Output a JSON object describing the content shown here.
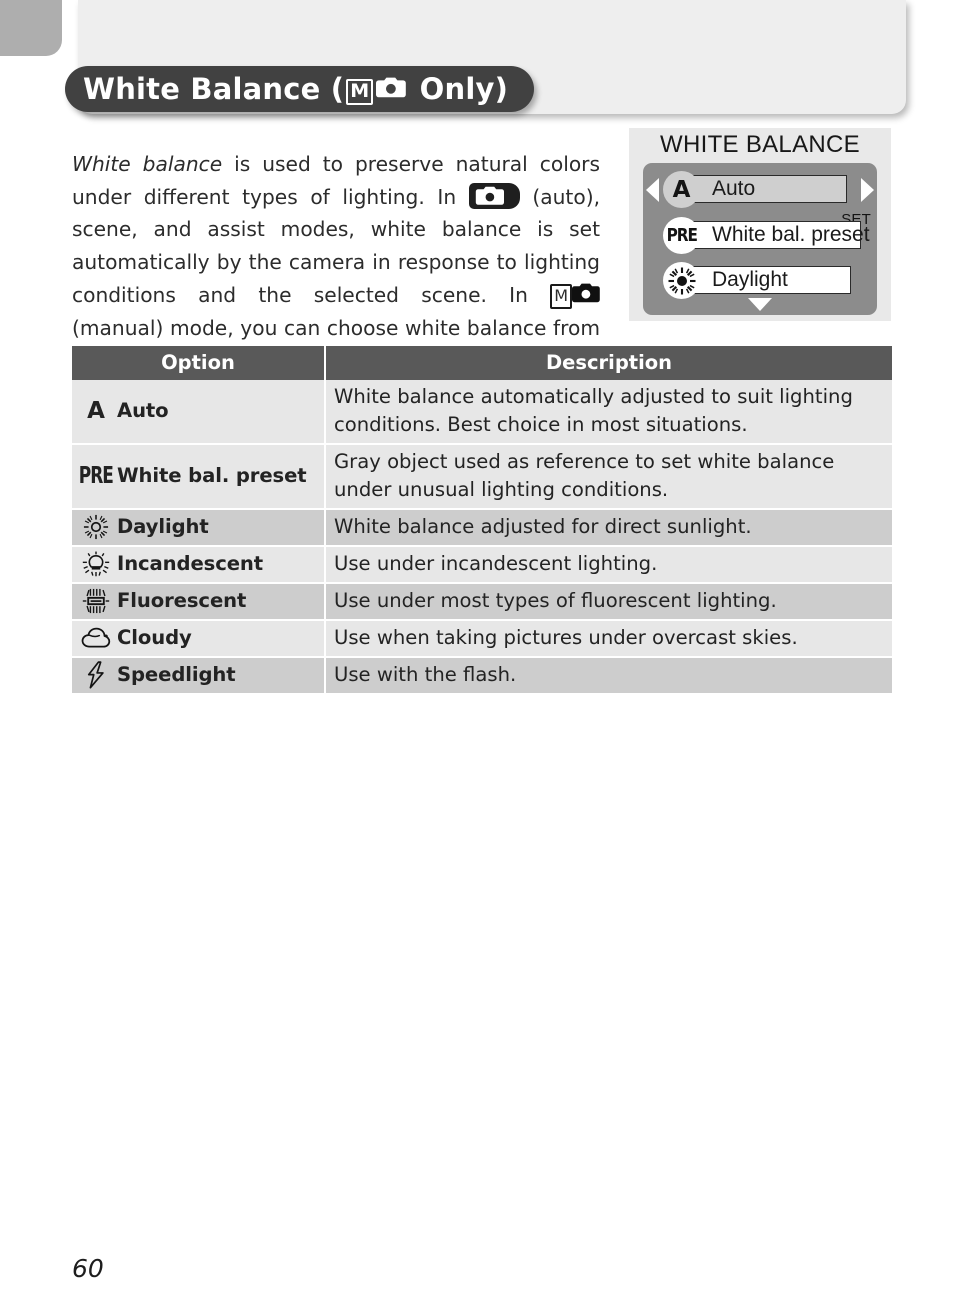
{
  "page": {
    "number": "60"
  },
  "header": {
    "title_before": "White Balance (",
    "mode_m_letter": "M",
    "mode_camera_icon": "camera-icon",
    "title_after": " Only)"
  },
  "body": {
    "lead_italic": "White balance",
    "text_1": " is used to preserve natural colors under different types of lighting.  In ",
    "auto_badge_icon": "auto-camera-badge-icon",
    "text_2": " (auto), scene, and assist modes, white balance is set automatically by the camera in response to lighting conditions and the selected scene.  In ",
    "manual_m_letter": "M",
    "manual_camera_icon": "camera-icon",
    "text_3": " (manual) mode, you can choose white balance from the following options:"
  },
  "lcd": {
    "title": "WHITE BALANCE",
    "set_label": "SET",
    "left_arrow": "left-arrow-icon",
    "right_arrow": "right-arrow-icon",
    "down_arrow": "down-arrow-icon",
    "items": [
      {
        "icon": "letter-a-icon",
        "icon_text": "A",
        "label": "Auto",
        "selected": true
      },
      {
        "icon": "pre-icon",
        "icon_text": "PRE",
        "label": "White bal. preset",
        "selected": false
      },
      {
        "icon": "sun-icon",
        "icon_text": "",
        "label": "Daylight",
        "selected": false
      }
    ]
  },
  "table": {
    "headers": {
      "option": "Option",
      "description": "Description"
    },
    "rows": [
      {
        "icon": "letter-a-icon",
        "icon_text": "A",
        "label": "Auto",
        "description": "White balance automatically adjusted to suit lighting conditions.  Best choice in most situations."
      },
      {
        "icon": "pre-icon",
        "icon_text": "PRE",
        "label": "White bal. preset",
        "description": "Gray object used as reference to set white balance under unusual lighting conditions."
      },
      {
        "icon": "sun-icon",
        "icon_text": "",
        "label": "Daylight",
        "description": "White balance adjusted for direct sunlight."
      },
      {
        "icon": "lightbulb-icon",
        "icon_text": "",
        "label": "Incandescent",
        "description": "Use under incandescent lighting."
      },
      {
        "icon": "fluorescent-tube-icon",
        "icon_text": "",
        "label": "Fluorescent",
        "description": "Use under most types of fluorescent lighting."
      },
      {
        "icon": "cloud-icon",
        "icon_text": "",
        "label": "Cloudy",
        "description": "Use when taking pictures under overcast skies."
      },
      {
        "icon": "flash-bolt-icon",
        "icon_text": "",
        "label": "Speedlight",
        "description": "Use with the flash."
      }
    ]
  },
  "colors": {
    "banner": "#414141",
    "table_header": "#595959",
    "row_dark": "#cdcdcd",
    "row_light": "#e7e7e7",
    "lcd_screen": "#8c8c8c",
    "corner_tab": "#aeaeae"
  }
}
